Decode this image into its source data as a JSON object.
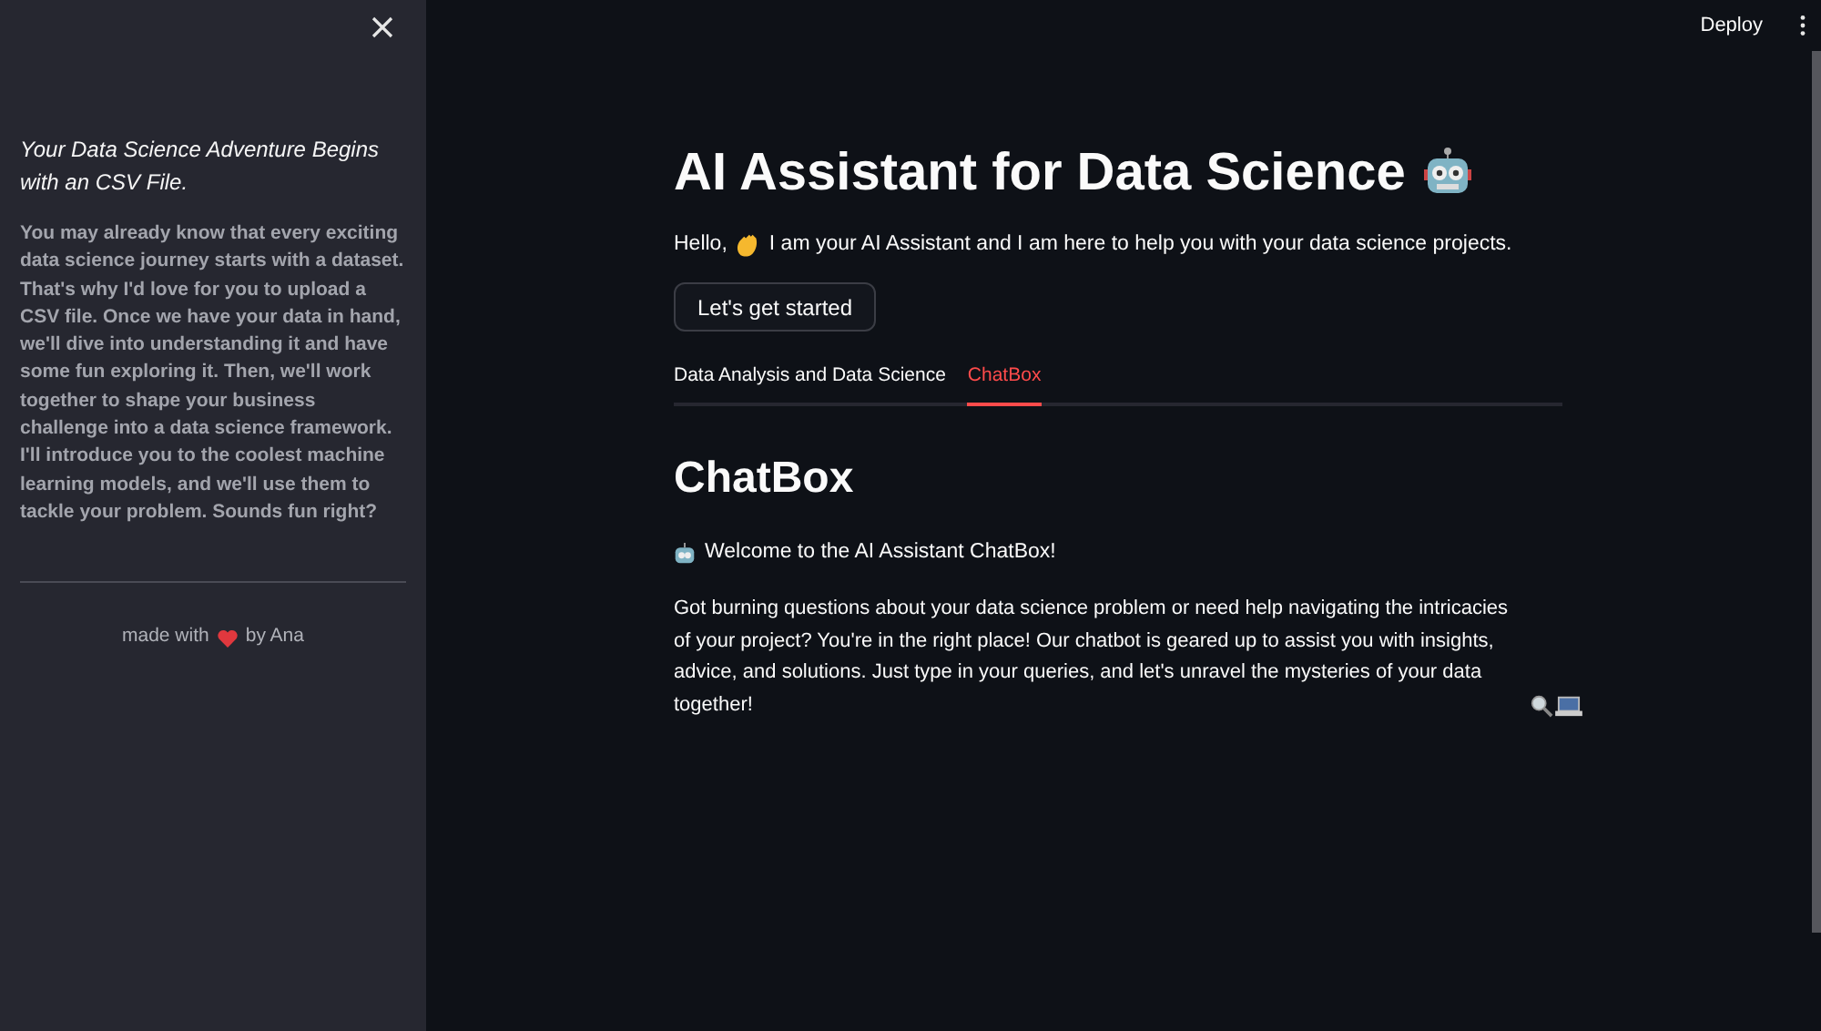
{
  "sidebar": {
    "heading": "Your Data Science Adventure Begins with an CSV File.",
    "body": "You may already know that every exciting data science journey starts with a dataset. That's why I'd love for you to upload a CSV file. Once we have your data in hand, we'll dive into understanding it and have some fun exploring it. Then, we'll work together to shape your business challenge into a data science framework. I'll introduce you to the coolest machine learning models, and we'll use them to tackle your problem. Sounds fun right?",
    "footer_before": "made with",
    "footer_after": "by Ana"
  },
  "toolbar": {
    "deploy": "Deploy"
  },
  "title": "AI Assistant for Data Science",
  "greeting_before": "Hello,",
  "greeting_after": "I am your AI Assistant and I am here to help you with your data science projects.",
  "start_button": "Let's get started",
  "tabs": [
    {
      "label": "Data Analysis and Data Science",
      "selected": false
    },
    {
      "label": "ChatBox",
      "selected": true
    }
  ],
  "chatbox": {
    "heading": "ChatBox",
    "welcome": "Welcome to the AI Assistant ChatBox!",
    "paragraph": "Got burning questions about your data science problem or need help navigating the intricacies of your project? You're in the right place! Our chatbot is geared up to assist you with insights, advice, and solutions. Just type in your queries, and let's unravel the mysteries of your data together!"
  }
}
